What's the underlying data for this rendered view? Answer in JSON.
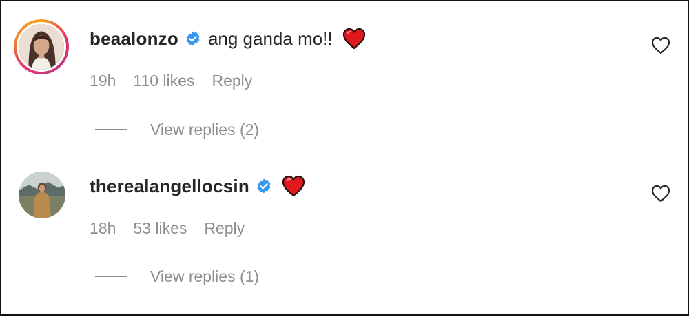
{
  "comments": [
    {
      "username": "beaalonzo",
      "text": "ang ganda mo!!",
      "emoji_icon": "red-heart-emoji",
      "verified": true,
      "has_story_ring": true,
      "time": "19h",
      "likes": "110 likes",
      "reply_label": "Reply",
      "view_replies": "View replies (2)",
      "like_icon": "heart-outline-icon"
    },
    {
      "username": "therealangellocsin",
      "text": "",
      "emoji_icon": "red-heart-emoji",
      "verified": true,
      "has_story_ring": false,
      "time": "18h",
      "likes": "53 likes",
      "reply_label": "Reply",
      "view_replies": "View replies (1)",
      "like_icon": "heart-outline-icon"
    }
  ],
  "colors": {
    "text_primary": "#262626",
    "text_secondary": "#8e8e8e",
    "verified_blue": "#3897f0",
    "heart_red": "#e0191f"
  }
}
